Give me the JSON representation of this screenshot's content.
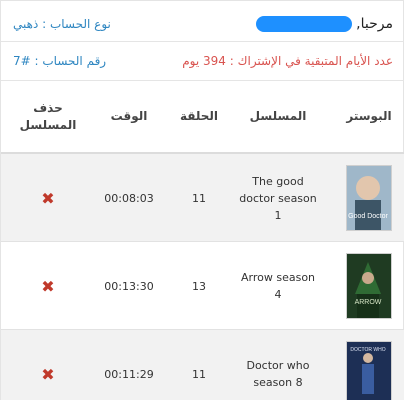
{
  "header": {
    "greeting": "مرحبا,",
    "account_type_label": "نوع الحساب : ذهبي",
    "remaining_days_label": "عدد الأيام المتبقية في الإشتراك : 394 يوم",
    "account_number_label": "رقم الحساب : #7"
  },
  "table": {
    "headers": {
      "poster": "البوستر",
      "series": "المسلسل",
      "episode": "الحلقة",
      "time": "الوقت",
      "delete": "حذف المسلسل"
    },
    "rows": [
      {
        "series": "The good doctor season 1",
        "poster_text": "Good Doctor",
        "episode": "11",
        "time": "00:08:03",
        "delete_icon": "✖"
      },
      {
        "series": "Arrow season 4",
        "poster_text": "ARROW",
        "episode": "13",
        "time": "00:13:30",
        "delete_icon": "✖"
      },
      {
        "series": "Doctor who season 8",
        "poster_text": "DOCTOR WHO",
        "episode": "11",
        "time": "00:11:29",
        "delete_icon": "✖"
      }
    ]
  },
  "colors": {
    "accent_blue": "#2e86c1",
    "days_red": "#d9534f",
    "delete_red": "#c0392b"
  }
}
